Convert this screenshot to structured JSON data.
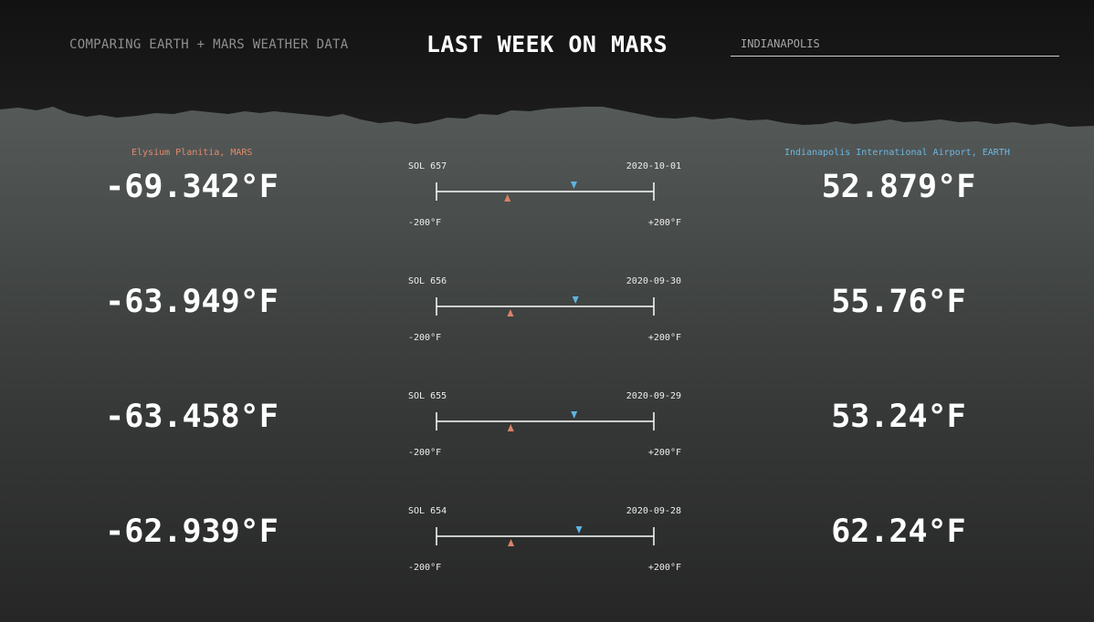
{
  "header": {
    "tagline": "COMPARING EARTH + MARS WEATHER DATA",
    "title": "LAST WEEK ON MARS",
    "city_value": "INDIANAPOLIS"
  },
  "locations": {
    "mars": "Elysium Planitia, MARS",
    "earth": "Indianapolis International Airport, EARTH"
  },
  "colors": {
    "mars_marker": "#d98368",
    "earth_marker": "#5fb4e0",
    "background_top": "#121212",
    "terrain": "#4e5352"
  },
  "scale": {
    "min_label": "-200°F",
    "max_label": "+200°F",
    "min": -200,
    "max": 200
  },
  "days": [
    {
      "sol": "SOL 657",
      "date": "2020-10-01",
      "mars_temp": "-69.342°F",
      "earth_temp": "52.879°F",
      "mars_value": -69.342,
      "earth_value": 52.879
    },
    {
      "sol": "SOL 656",
      "date": "2020-09-30",
      "mars_temp": "-63.949°F",
      "earth_temp": "55.76°F",
      "mars_value": -63.949,
      "earth_value": 55.76
    },
    {
      "sol": "SOL 655",
      "date": "2020-09-29",
      "mars_temp": "-63.458°F",
      "earth_temp": "53.24°F",
      "mars_value": -63.458,
      "earth_value": 53.24
    },
    {
      "sol": "SOL 654",
      "date": "2020-09-28",
      "mars_temp": "-62.939°F",
      "earth_temp": "62.24°F",
      "mars_value": -62.939,
      "earth_value": 62.24
    }
  ]
}
